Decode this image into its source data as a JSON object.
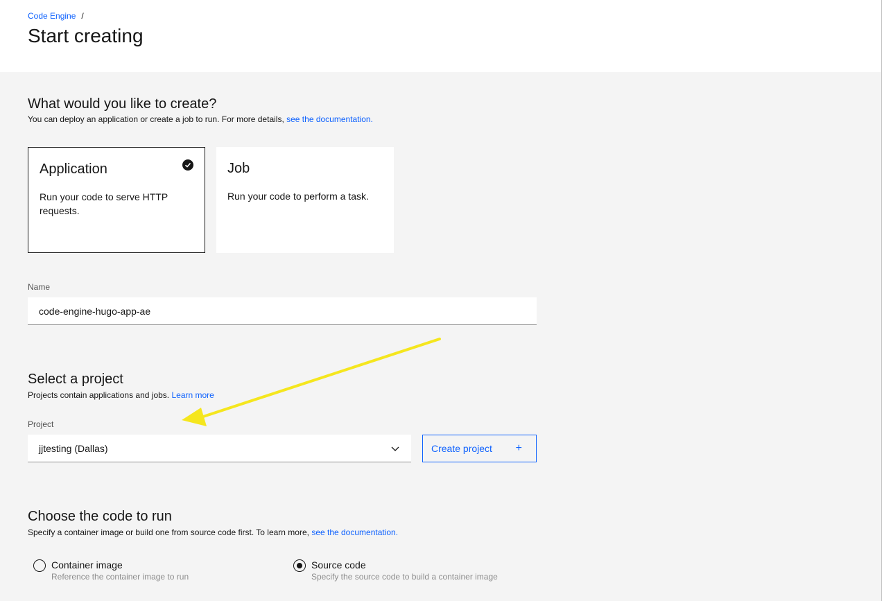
{
  "breadcrumb": {
    "link": "Code Engine",
    "separator": "/"
  },
  "page_title": "Start creating",
  "create_section": {
    "title": "What would you like to create?",
    "desc_prefix": "You can deploy an application or create a job to run. For more details, ",
    "desc_link": "see the documentation."
  },
  "tiles": [
    {
      "title": "Application",
      "desc": "Run your code to serve HTTP requests.",
      "selected": true,
      "icon": "checkmark-filled-icon"
    },
    {
      "title": "Job",
      "desc": "Run your code to perform a task.",
      "selected": false
    }
  ],
  "name_field": {
    "label": "Name",
    "value": "code-engine-hugo-app-ae"
  },
  "project_section": {
    "title": "Select a project",
    "desc_prefix": "Projects contain applications and jobs. ",
    "desc_link": "Learn more"
  },
  "project_field": {
    "label": "Project",
    "value": "jjtesting (Dallas)",
    "icon": "chevron-down-icon"
  },
  "create_project_button": {
    "label": "Create project",
    "icon": "+"
  },
  "code_section": {
    "title": "Choose the code to run",
    "desc_prefix": "Specify a container image or build one from source code first. To learn more, ",
    "desc_link": "see the documentation."
  },
  "code_options": [
    {
      "label": "Container image",
      "help": "Reference the container image to run",
      "checked": false
    },
    {
      "label": "Source code",
      "help": "Specify the source code to build a container image",
      "checked": true
    }
  ],
  "annotation": {
    "arrow_color": "#f5e61e"
  },
  "colors": {
    "link": "#0f62fe",
    "background": "#f4f4f4",
    "text": "#161616"
  }
}
